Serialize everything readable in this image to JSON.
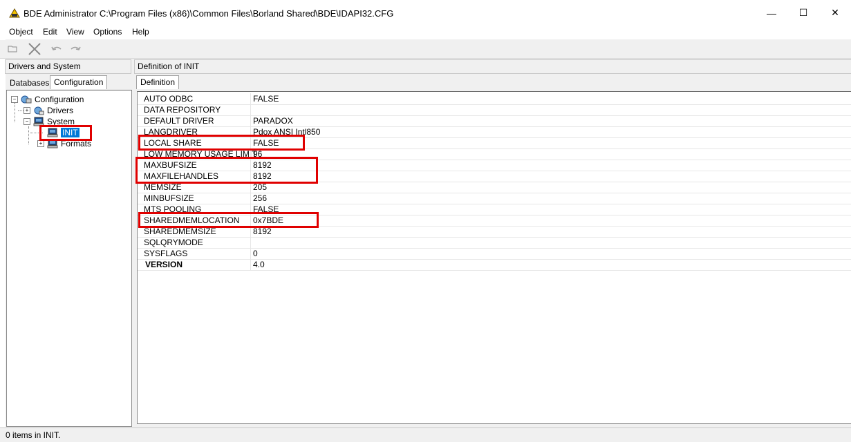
{
  "window": {
    "title": "BDE Administrator  C:\\Program Files (x86)\\Common Files\\Borland Shared\\BDE\\IDAPI32.CFG",
    "controls": {
      "minimize": "—",
      "maximize": "☐",
      "close": "✕"
    }
  },
  "menu": [
    "Object",
    "Edit",
    "View",
    "Options",
    "Help"
  ],
  "left_panel": {
    "header": "Drivers and System",
    "tabs": [
      "Databases",
      "Configuration"
    ],
    "active_tab": "Configuration",
    "tree": [
      {
        "label": "Configuration",
        "expander": "−",
        "icon": "configuration-icon"
      },
      {
        "label": "Drivers",
        "expander": "+",
        "icon": "drivers-icon"
      },
      {
        "label": "System",
        "expander": "−",
        "icon": "system-icon"
      },
      {
        "label": "INIT",
        "expander": "",
        "icon": "computer-icon",
        "selected": true
      },
      {
        "label": "Formats",
        "expander": "+",
        "icon": "computer-icon"
      }
    ]
  },
  "right_panel": {
    "header": "Definition of INIT",
    "tab": "Definition",
    "rows": [
      {
        "key": "AUTO ODBC",
        "value": "FALSE"
      },
      {
        "key": "DATA REPOSITORY",
        "value": ""
      },
      {
        "key": "DEFAULT DRIVER",
        "value": "PARADOX"
      },
      {
        "key": "LANGDRIVER",
        "value": "Pdox ANSI Intl850"
      },
      {
        "key": "LOCAL SHARE",
        "value": "FALSE"
      },
      {
        "key": "LOW MEMORY USAGE LIMIT",
        "value": "96"
      },
      {
        "key": "MAXBUFSIZE",
        "value": "8192"
      },
      {
        "key": "MAXFILEHANDLES",
        "value": "8192"
      },
      {
        "key": "MEMSIZE",
        "value": "205"
      },
      {
        "key": "MINBUFSIZE",
        "value": "256"
      },
      {
        "key": "MTS POOLING",
        "value": "FALSE"
      },
      {
        "key": "SHAREDMEMLOCATION",
        "value": "0x7BDE"
      },
      {
        "key": "SHAREDMEMSIZE",
        "value": "8192"
      },
      {
        "key": "SQLQRYMODE",
        "value": ""
      },
      {
        "key": "SYSFLAGS",
        "value": "0"
      },
      {
        "key": "VERSION",
        "value": "4.0",
        "bold": true
      }
    ]
  },
  "status": "0 items in INIT.",
  "colors": {
    "highlight": "#e00000",
    "selection": "#0078d7"
  }
}
